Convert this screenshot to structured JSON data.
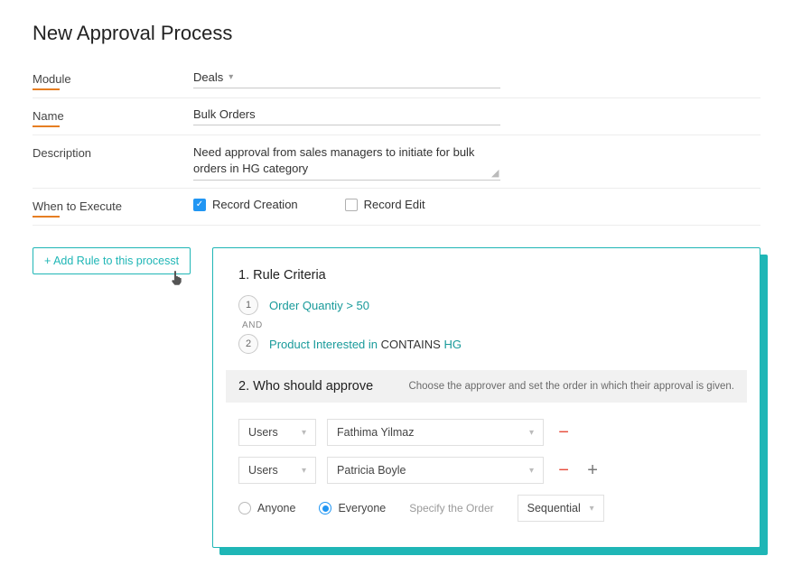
{
  "page": {
    "title": "New Approval Process"
  },
  "form": {
    "module_label": "Module",
    "module_value": "Deals",
    "name_label": "Name",
    "name_value": "Bulk Orders",
    "description_label": "Description",
    "description_value": "Need approval from sales managers to initiate for bulk orders in HG category",
    "when_label": "When to Execute",
    "record_creation_label": "Record Creation",
    "record_edit_label": "Record Edit"
  },
  "add_rule_btn": "+ Add Rule to this processt",
  "rule": {
    "criteria_title": "1. Rule Criteria",
    "criteria": [
      {
        "num": "1",
        "field": "Order Quantiy",
        "op": ">",
        "value": "50"
      },
      {
        "num": "2",
        "field": "Product Interested in",
        "op": "CONTAINS",
        "value": "HG"
      }
    ],
    "and_label": "AND",
    "approve_title": "2. Who should approve",
    "approve_hint": "Choose the approver and set the order in which their approval is given."
  },
  "approvers": {
    "type_label": "Users",
    "rows": [
      {
        "type": "Users",
        "name": "Fathima Yilmaz"
      },
      {
        "type": "Users",
        "name": "Patricia Boyle"
      }
    ]
  },
  "options": {
    "anyone": "Anyone",
    "everyone": "Everyone",
    "order_label": "Specify the Order",
    "order_value": "Sequential"
  }
}
